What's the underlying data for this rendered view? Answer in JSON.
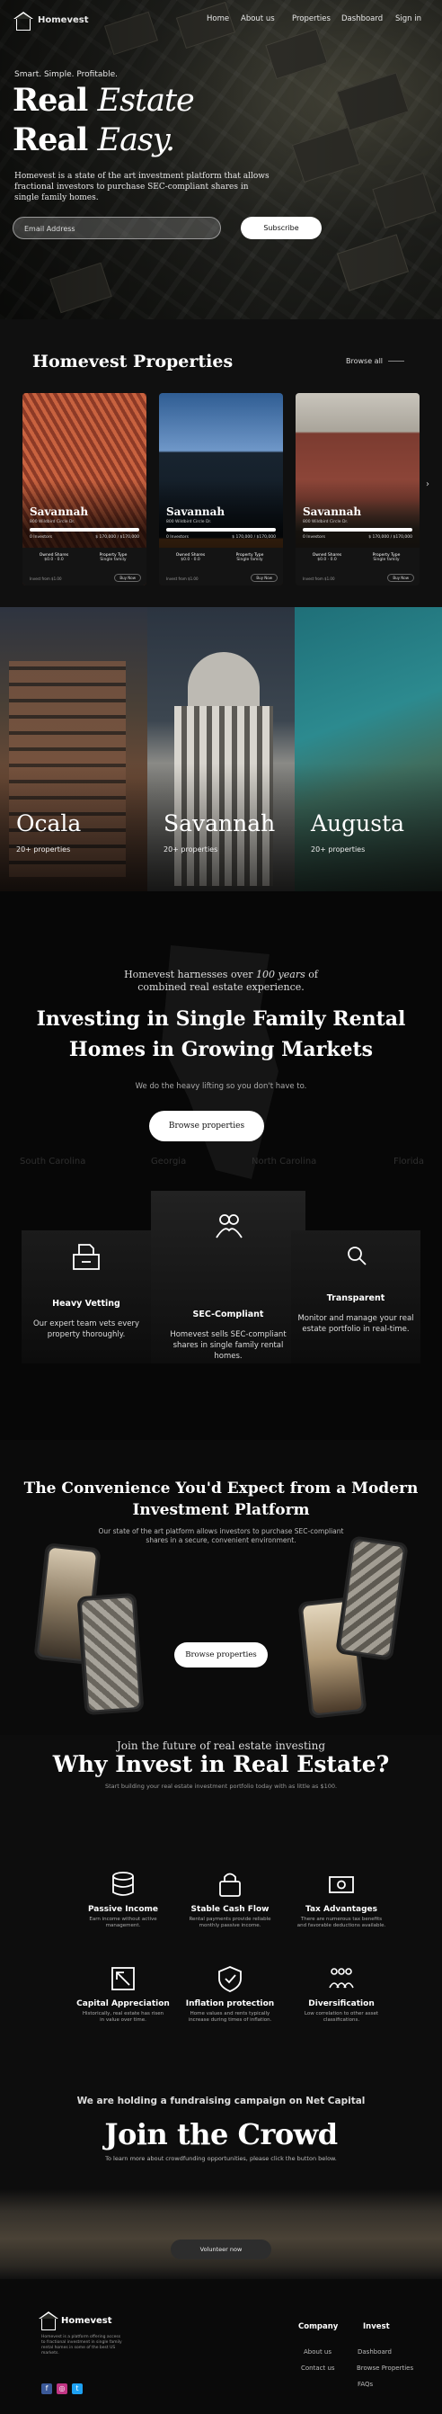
{
  "nav": {
    "brand": "Homevest",
    "links": [
      "Home",
      "About us",
      "Properties",
      "Dashboard"
    ],
    "signin": "Sign in"
  },
  "hero": {
    "tagline": "Smart. Simple. Profitable.",
    "title_line1_a": "Real ",
    "title_line1_b": "Estate",
    "title_line2_a": "Real ",
    "title_line2_b": "Easy.",
    "description": "Homevest is a state of the art investment platform that allows fractional investors to purchase SEC-compliant shares in single family homes.",
    "email_placeholder": "Email Address",
    "subscribe_label": "Subscribe"
  },
  "properties": {
    "title": "Homevest Properties",
    "browse_all": "Browse all",
    "next_icon": "chevron-right-icon",
    "cards": [
      {
        "city": "Savannah",
        "address": "800 Wildbird Circle Dr.",
        "stats_left": "0 Investors",
        "stats_right": "$ 170,000 / $170,000",
        "col1_label": "Owned Shares",
        "col1_value": "$0.0 · 0.0",
        "col2_label": "Property Type",
        "col2_value": "Single family",
        "foot": "Invest from $1.00",
        "btn": "Buy Now"
      },
      {
        "city": "Savannah",
        "address": "800 Wildbird Circle Dr.",
        "stats_left": "0 Investors",
        "stats_right": "$ 170,000 / $170,000",
        "col1_label": "Owned Shares",
        "col1_value": "$0.0 · 0.0",
        "col2_label": "Property Type",
        "col2_value": "Single family",
        "foot": "Invest from $1.00",
        "btn": "Buy Now"
      },
      {
        "city": "Savannah",
        "address": "800 Wildbird Circle Dr.",
        "stats_left": "0 Investors",
        "stats_right": "$ 170,000 / $170,000",
        "col1_label": "Owned Shares",
        "col1_value": "$0.0 · 0.0",
        "col2_label": "Property Type",
        "col2_value": "Single family",
        "foot": "Invest from $1.00",
        "btn": "Buy Now"
      }
    ]
  },
  "cities": [
    {
      "name": "Ocala",
      "count": "20+ properties"
    },
    {
      "name": "Savannah",
      "count": "20+ properties"
    },
    {
      "name": "Augusta",
      "count": "20+ properties"
    }
  ],
  "investing": {
    "pre_a": "Homevest harnesses over ",
    "pre_em": "100 years",
    "pre_b": " of",
    "pre_line2": "combined real estate experience.",
    "title_line1": "Investing in Single Family Rental",
    "title_line2": "Homes in Growing Markets",
    "subtitle": "We do the heavy lifting so you don't have to.",
    "button": "Browse properties",
    "states": [
      "South Carolina",
      "Georgia",
      "North Carolina",
      "Florida"
    ],
    "features": [
      {
        "title": "Heavy Vetting",
        "desc_line1": "Our expert team vets every",
        "desc_line2": "property thoroughly.",
        "desc_line3": ""
      },
      {
        "title": "SEC-Compliant",
        "desc_line1": "Homevest sells SEC-compliant",
        "desc_line2": "shares in single family rental",
        "desc_line3": "homes."
      },
      {
        "title": "Transparent",
        "desc_line1": "Monitor and manage your real",
        "desc_line2": "estate portfolio in real-time.",
        "desc_line3": ""
      }
    ]
  },
  "convenience": {
    "title_line1": "The Convenience You'd Expect from a Modern",
    "title_line2": "Investment Platform",
    "sub_line1": "Our state of the art platform allows investors to purchase SEC-compliant",
    "sub_line2": "shares in a secure, convenient environment.",
    "button": "Browse properties"
  },
  "why": {
    "pre": "Join the future of real estate investing",
    "title": "Why Invest in Real Estate?",
    "subtitle": "Start building your real estate investment portfolio today with as little as $100.",
    "benefits": [
      {
        "icon": "database-icon",
        "title": "Passive Income",
        "desc_line1": "Earn income without active",
        "desc_line2": "management."
      },
      {
        "icon": "lock-icon",
        "title": "Stable Cash Flow",
        "desc_line1": "Rental payments provide reliable",
        "desc_line2": "monthly passive income."
      },
      {
        "icon": "money-bill-icon",
        "title": "Tax Advantages",
        "desc_line1": "There are numerous tax benefits",
        "desc_line2": "and favorable deductions available."
      },
      {
        "icon": "arrow-up-left-icon",
        "title": "Capital Appreciation",
        "desc_line1": "Historically, real estate has risen",
        "desc_line2": "in value over time."
      },
      {
        "icon": "shield-check-icon",
        "title": "Inflation protection",
        "desc_line1": "Home values and rents typically",
        "desc_line2": "increase during times of inflation."
      },
      {
        "icon": "people-icon",
        "title": "Diversification",
        "desc_line1": "Low correlation to other asset",
        "desc_line2": "classifications."
      }
    ]
  },
  "crowd": {
    "pre": "We are holding a fundraising campaign on Net Capital",
    "title": "Join the Crowd",
    "subtitle": "To learn more about crowdfunding opportunities, please click the button below.",
    "button": "Volunteer now"
  },
  "footer": {
    "brand": "Homevest",
    "desc_line1": "Homevest is a platform offering access",
    "desc_line2": "to fractional investment in single family",
    "desc_line3": "rental homes in some of the best US",
    "desc_line4": "markets.",
    "company_heading": "Company",
    "company_links": [
      "About us",
      "Contact us"
    ],
    "invest_heading": "Invest",
    "invest_links": [
      "Dashboard",
      "Browse Properties",
      "FAQs"
    ],
    "social": [
      {
        "icon": "facebook-icon",
        "glyph": "f",
        "color": "#3b5998"
      },
      {
        "icon": "instagram-icon",
        "glyph": "◎",
        "color": "#c13584"
      },
      {
        "icon": "twitter-icon",
        "glyph": "t",
        "color": "#1da1f2"
      }
    ]
  }
}
